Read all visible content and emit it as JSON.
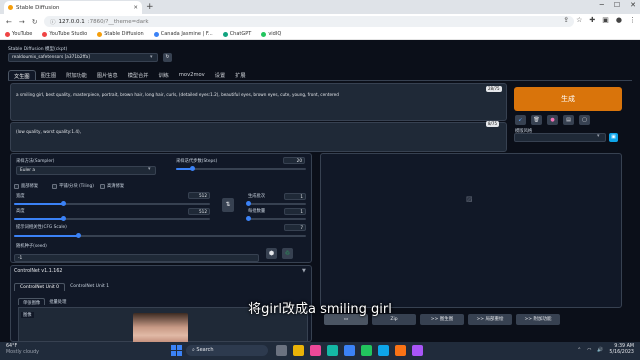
{
  "browser": {
    "tab_title": "Stable Diffusion",
    "url_host": "127.0.0.1",
    "url_rest": ":7860/?__theme=dark",
    "bookmarks": [
      "YouTube",
      "YouTube Studio",
      "Stable Diffusion",
      "Canada Jasmine | F...",
      "ChatGPT",
      "vidIQ"
    ]
  },
  "app": {
    "checkpoint_label": "Stable Diffusion 模型(ckpt)",
    "checkpoint_value": "realdoumix_safetensors [a371b2ffa]",
    "tabs": [
      "文生图",
      "图生图",
      "附加功能",
      "图片信息",
      "模型合并",
      "训练",
      "mov2mov",
      "设置",
      "扩展"
    ],
    "prompt": "a smiling girl, best quality, masterpiece, portrait, brown hair, long hair, curls, (detailed eyes:1.2), beautiful eyes, brown eyes, cute, young, front, centered",
    "prompt_counter": "28/75",
    "negative_prompt": "(low quality, worst quality:1.4),",
    "negative_counter": "8/75",
    "generate_label": "生成",
    "styles_label": "模版风格",
    "sampler_label": "采样方法(Sampler)",
    "sampler_value": "Euler a",
    "steps_label": "采样迭代步数(Steps)",
    "steps_value": "20",
    "face_restore_label": "面部修复",
    "tiling_label": "平铺/分块 (Tiling)",
    "hires_label": "高清修复",
    "width_label": "宽度",
    "width_value": "512",
    "height_label": "高度",
    "height_value": "512",
    "batch_count_label": "生成批次",
    "batch_count_value": "1",
    "batch_size_label": "每批数量",
    "batch_size_value": "1",
    "cfg_label": "提示词相关性(CFG Scale)",
    "cfg_value": "7",
    "seed_label": "随机种子(seed)",
    "seed_value": "-1",
    "steps_fraction": 0.13,
    "width_fraction": 0.25,
    "height_fraction": 0.25,
    "cfg_fraction": 0.22
  },
  "controlnet": {
    "title": "ControlNet v1.1.162",
    "unit0": "ControlNet Unit 0",
    "unit1": "ControlNet Unit 1",
    "subtab_single": "单张图像",
    "subtab_batch": "批量处理",
    "image_label": "图像"
  },
  "output": {
    "buttons": [
      "Zip",
      ">> 图生图",
      ">> 局部重绘",
      ">> 附加功能"
    ]
  },
  "caption": "将girl改成a smiling girl",
  "taskbar": {
    "weather_temp": "64°F",
    "weather_desc": "Mostly cloudy",
    "search_placeholder": "Search",
    "time": "9:39 AM",
    "date": "5/16/2023"
  },
  "colors": {
    "generate": "#d9740b",
    "accent": "#3b82f6",
    "bg": "#0b0f19"
  }
}
